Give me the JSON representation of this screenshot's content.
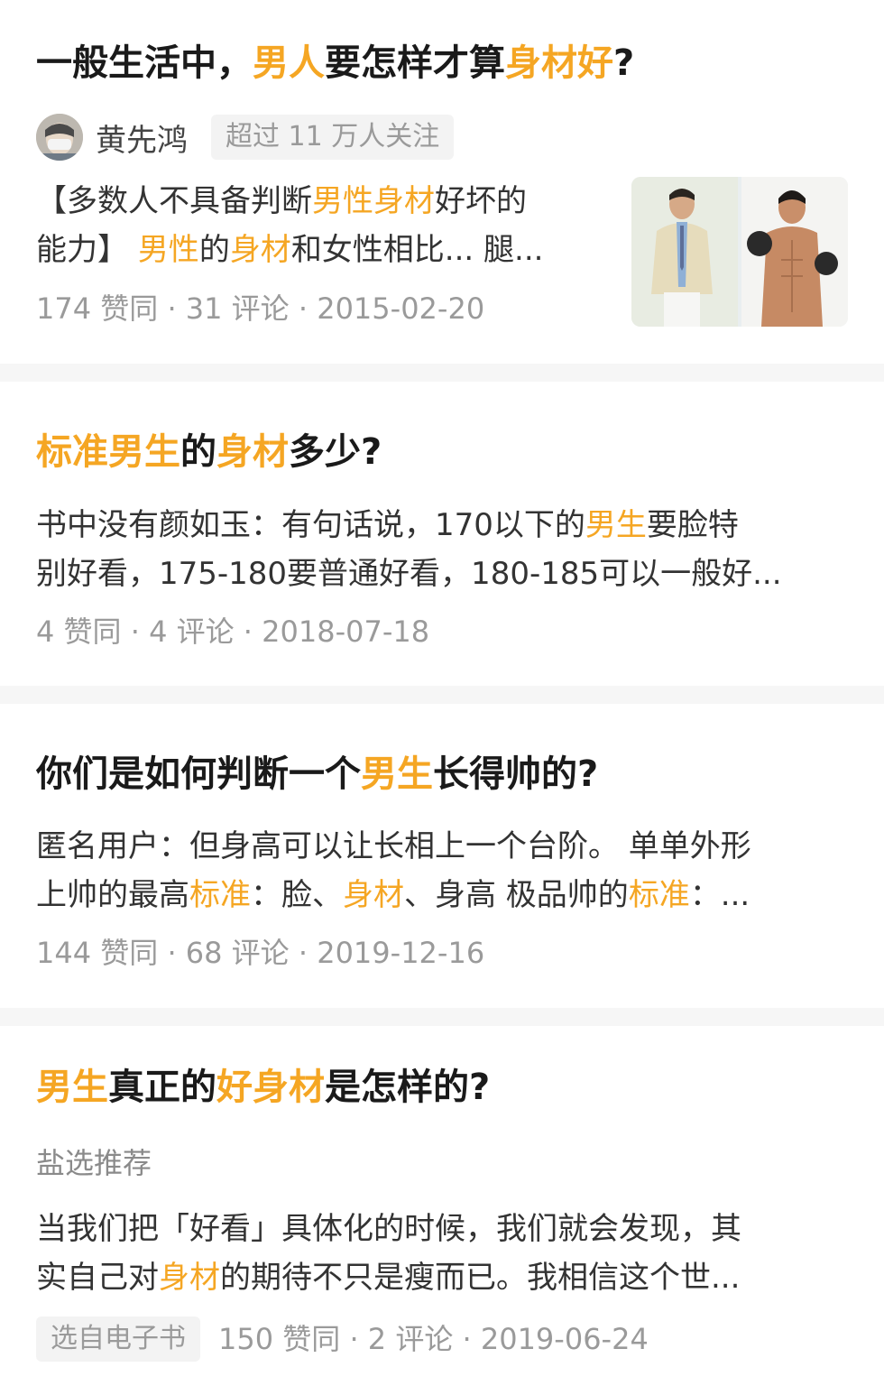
{
  "cards": [
    {
      "title_parts": [
        {
          "text": "一般生活中，",
          "hl": false
        },
        {
          "text": "男人",
          "hl": true
        },
        {
          "text": "要怎样才算",
          "hl": false
        },
        {
          "text": "身材好",
          "hl": true
        },
        {
          "text": "?",
          "hl": false
        }
      ],
      "author": "黄先鸿",
      "follow_badge": "超过 11 万人关注",
      "excerpt_lines": [
        [
          {
            "text": "【多数人不具备判断",
            "hl": false
          },
          {
            "text": "男性身材",
            "hl": true
          },
          {
            "text": "好坏的",
            "hl": false
          }
        ],
        [
          {
            "text": "能力】 ",
            "hl": false
          },
          {
            "text": "男性",
            "hl": true
          },
          {
            "text": "的",
            "hl": false
          },
          {
            "text": "身材",
            "hl": true
          },
          {
            "text": "和女性相比... 腿...",
            "hl": false
          }
        ]
      ],
      "meta": {
        "likes": "174 赞同",
        "comments": "31 评论",
        "date": "2015-02-20"
      }
    },
    {
      "title_parts": [
        {
          "text": "标准男生",
          "hl": true
        },
        {
          "text": "的",
          "hl": false
        },
        {
          "text": "身材",
          "hl": true
        },
        {
          "text": "多少?",
          "hl": false
        }
      ],
      "excerpt_lines": [
        [
          {
            "text": "书中没有颜如玉：有句话说，170以下的",
            "hl": false
          },
          {
            "text": "男生",
            "hl": true
          },
          {
            "text": "要脸特",
            "hl": false
          }
        ],
        [
          {
            "text": "别好看，175-180要普通好看，180-185可以一般好...",
            "hl": false
          }
        ]
      ],
      "meta": {
        "likes": "4 赞同",
        "comments": "4 评论",
        "date": "2018-07-18"
      }
    },
    {
      "title_parts": [
        {
          "text": "你们是如何判断一个",
          "hl": false
        },
        {
          "text": "男生",
          "hl": true
        },
        {
          "text": "长得帅的?",
          "hl": false
        }
      ],
      "excerpt_lines": [
        [
          {
            "text": "匿名用户：但身高可以让长相上一个台阶。 单单外形",
            "hl": false
          }
        ],
        [
          {
            "text": "上帅的最高",
            "hl": false
          },
          {
            "text": "标准",
            "hl": true
          },
          {
            "text": "：脸、",
            "hl": false
          },
          {
            "text": "身材",
            "hl": true
          },
          {
            "text": "、身高 极品帅的",
            "hl": false
          },
          {
            "text": "标准",
            "hl": true
          },
          {
            "text": "：...",
            "hl": false
          }
        ]
      ],
      "meta": {
        "likes": "144 赞同",
        "comments": "68 评论",
        "date": "2019-12-16"
      }
    },
    {
      "title_parts": [
        {
          "text": "男生",
          "hl": true
        },
        {
          "text": "真正的",
          "hl": false
        },
        {
          "text": "好身材",
          "hl": true
        },
        {
          "text": "是怎样的?",
          "hl": false
        }
      ],
      "source": "盐选推荐",
      "excerpt_lines": [
        [
          {
            "text": "当我们把「好看」具体化的时候，我们就会发现，其",
            "hl": false
          }
        ],
        [
          {
            "text": "实自己对",
            "hl": false
          },
          {
            "text": "身材",
            "hl": true
          },
          {
            "text": "的期待不只是瘦而已。我相信这个世...",
            "hl": false
          }
        ]
      ],
      "badge": "选自电子书",
      "meta": {
        "likes": "150 赞同",
        "comments": "2 评论",
        "date": "2019-06-24"
      }
    }
  ],
  "separator": " · ",
  "colors": {
    "highlight": "#f5a623",
    "text": "#1a1a1a",
    "meta": "#9a9a9a",
    "separator_bg": "#f6f6f6"
  },
  "icons": {
    "avatar": "avatar-image",
    "thumbnail": "article-thumbnail-image"
  }
}
